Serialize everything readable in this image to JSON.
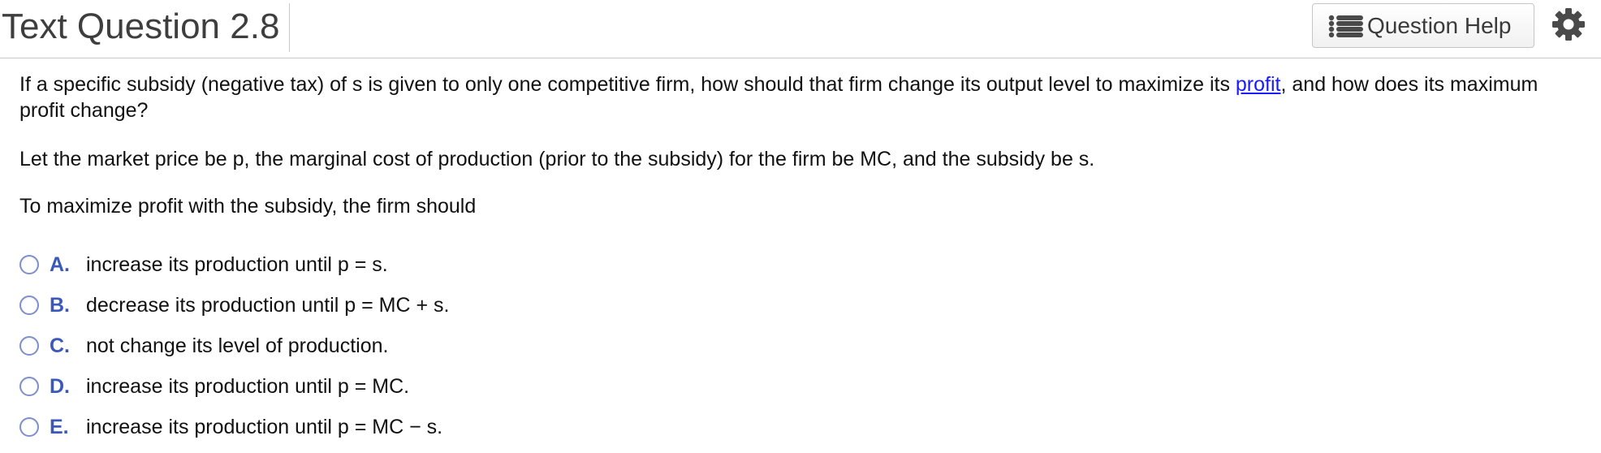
{
  "header": {
    "title": "Text Question 2.8",
    "help_label": "Question Help",
    "help_icon": "list-icon",
    "settings_icon": "gear-icon"
  },
  "question": {
    "paragraph1_before_link": "If a specific subsidy (negative tax) of s is given to only one competitive firm, how should that firm change its output level to maximize its ",
    "link_text": "profit",
    "paragraph1_after_link": ", and how does its maximum profit change?",
    "paragraph2": "Let the market price be p, the marginal cost of production (prior to the subsidy) for the firm be MC, and the subsidy be s.",
    "paragraph3": "To maximize profit with the subsidy, the firm should"
  },
  "options": [
    {
      "letter": "A.",
      "text": "increase its production until p = s."
    },
    {
      "letter": "B.",
      "text": "decrease its production until p = MC + s."
    },
    {
      "letter": "C.",
      "text": "not change its level of production."
    },
    {
      "letter": "D.",
      "text": "increase its production until p = MC."
    },
    {
      "letter": "E.",
      "text": "increase its production until p = MC − s."
    }
  ],
  "colors": {
    "option_letter": "#3b59b8",
    "link": "#1a1aff",
    "radio_border": "#7f8fc8"
  }
}
